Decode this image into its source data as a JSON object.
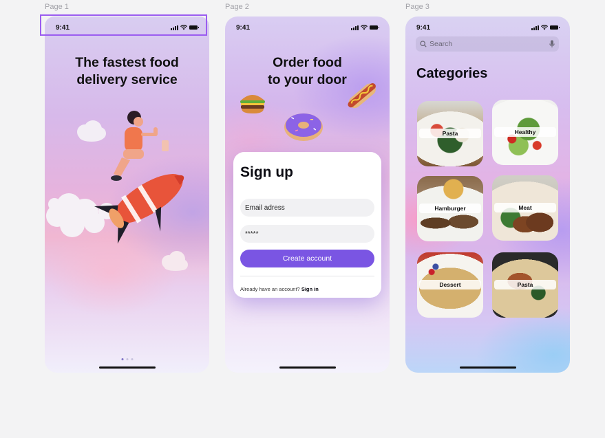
{
  "pages": [
    {
      "label": "Page 1"
    },
    {
      "label": "Page 2"
    },
    {
      "label": "Page 3"
    }
  ],
  "status_time": "9:41",
  "page1": {
    "headline_line1": "The fastest food",
    "headline_line2": "delivery service",
    "pager": {
      "count": 3,
      "active": 1
    }
  },
  "page2": {
    "headline_line1": "Order food",
    "headline_line2": "to your door",
    "card": {
      "title": "Sign up",
      "email_placeholder": "Email adress",
      "password_value": "*****",
      "create_label": "Create account",
      "account_prompt": "Already have an account?",
      "signin_label": "Sign in"
    }
  },
  "page3": {
    "search_placeholder": "Search",
    "title": "Categories",
    "categories": [
      {
        "label": "Pasta"
      },
      {
        "label": "Healthy"
      },
      {
        "label": "Hamburger"
      },
      {
        "label": "Meat"
      },
      {
        "label": "Dessert"
      },
      {
        "label": "Pasta"
      }
    ]
  },
  "colors": {
    "accent": "#7a55e3",
    "selection": "#9b5cf0",
    "canvas": "#f3f3f4"
  }
}
